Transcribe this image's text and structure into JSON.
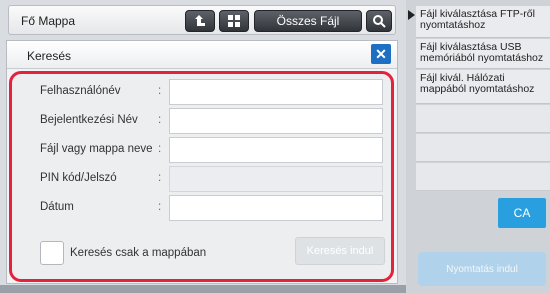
{
  "topbar": {
    "title": "Fő Mappa",
    "all_files_label": "Összes Fájl"
  },
  "dialog": {
    "title": "Keresés",
    "close_symbol": "✕",
    "fields": [
      {
        "label": "Felhasználónév",
        "value": ""
      },
      {
        "label": "Bejelentkezési Név",
        "value": ""
      },
      {
        "label": "Fájl vagy mappa neve",
        "value": ""
      },
      {
        "label": "PIN kód/Jelszó",
        "value": ""
      },
      {
        "label": "Dátum",
        "value": ""
      }
    ],
    "colon": ":",
    "checkbox_label": "Keresés csak a mappában",
    "search_button_label": "Keresés indul"
  },
  "right_panel": {
    "items": [
      "Fájl kiválasztása FTP-ről nyomtatáshoz",
      "Fájl kiválasztása USB memóriából nyomtatáshoz",
      "Fájl kivál. Hálózati mappából nyomtatáshoz"
    ],
    "ca_label": "CA",
    "print_label": "Nyomtatás indul"
  },
  "colors": {
    "accent_red": "#e3233b",
    "close_blue": "#1c6fc3",
    "ca_blue": "#2a9fe0"
  }
}
